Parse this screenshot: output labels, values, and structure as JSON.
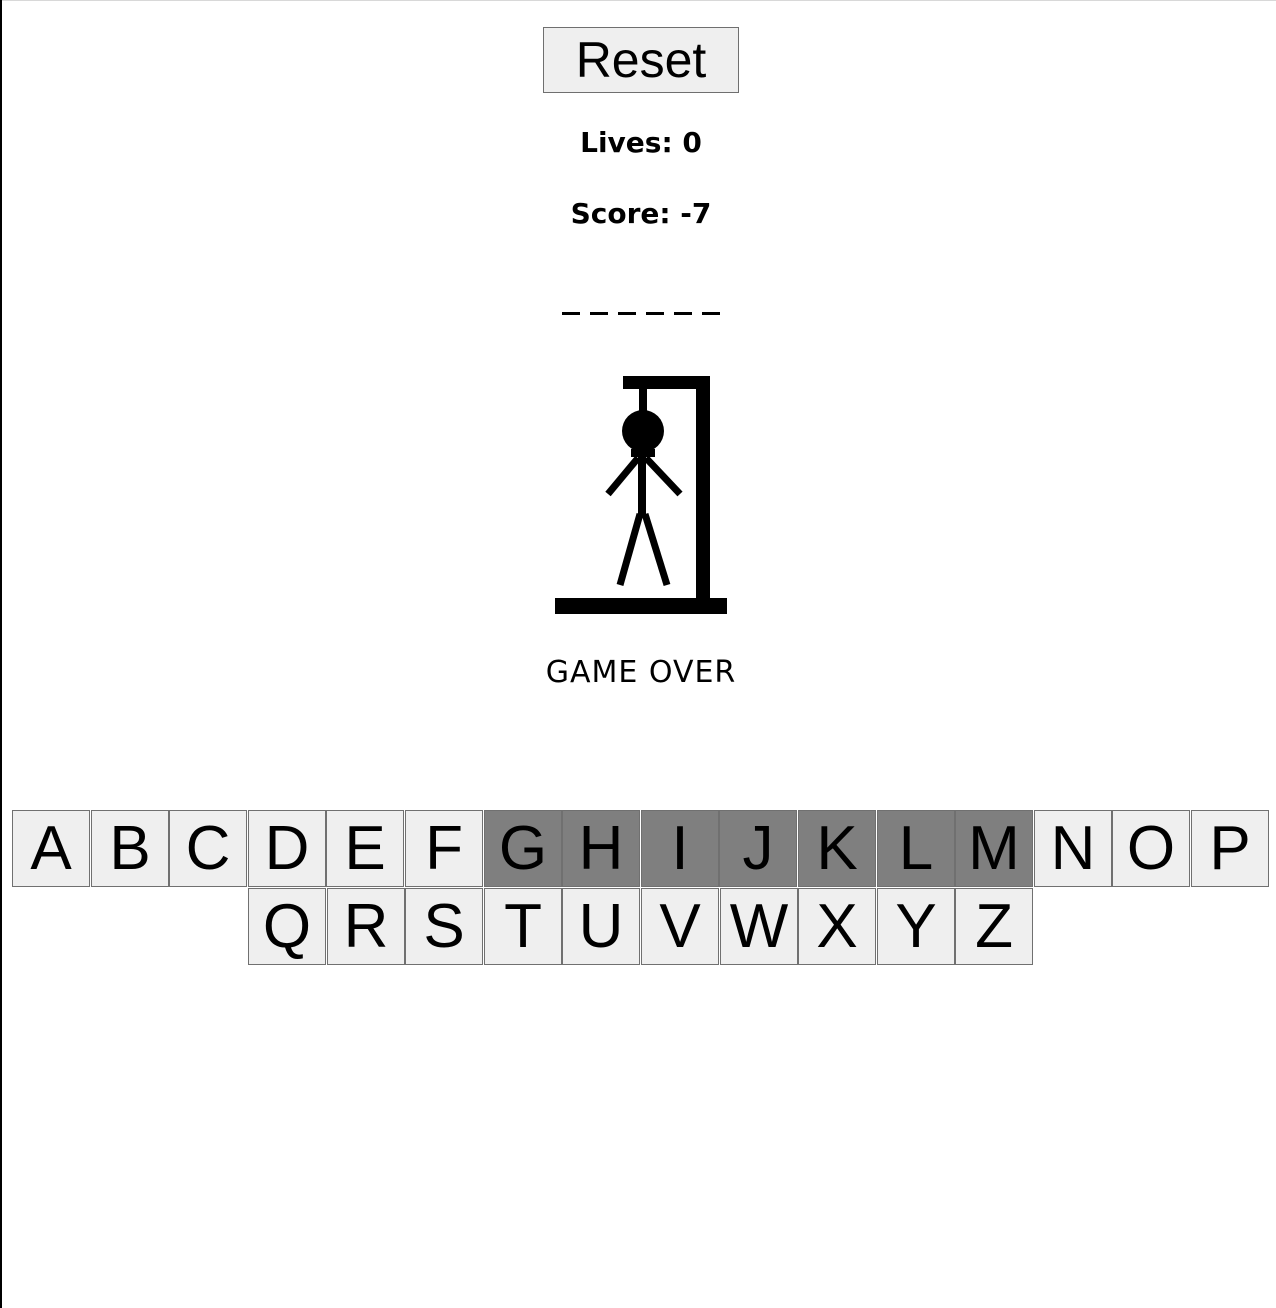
{
  "controls": {
    "reset_label": "Reset"
  },
  "stats": {
    "lives_label": "Lives: 0",
    "score_label": "Score: -7"
  },
  "word": {
    "letters": [
      "",
      "",
      "",
      "",
      "",
      ""
    ]
  },
  "status": {
    "message": "GAME OVER"
  },
  "keyboard": {
    "row1": [
      "A",
      "B",
      "C",
      "D",
      "E",
      "F",
      "G",
      "H",
      "I",
      "J",
      "K",
      "L",
      "M",
      "N",
      "O",
      "P"
    ],
    "row2": [
      "Q",
      "R",
      "S",
      "T",
      "U",
      "V",
      "W",
      "X",
      "Y",
      "Z"
    ],
    "used_letters": [
      "G",
      "H",
      "I",
      "J",
      "K",
      "L",
      "M"
    ],
    "used_color": "#7f7f7f",
    "available_color": "#efefef"
  }
}
